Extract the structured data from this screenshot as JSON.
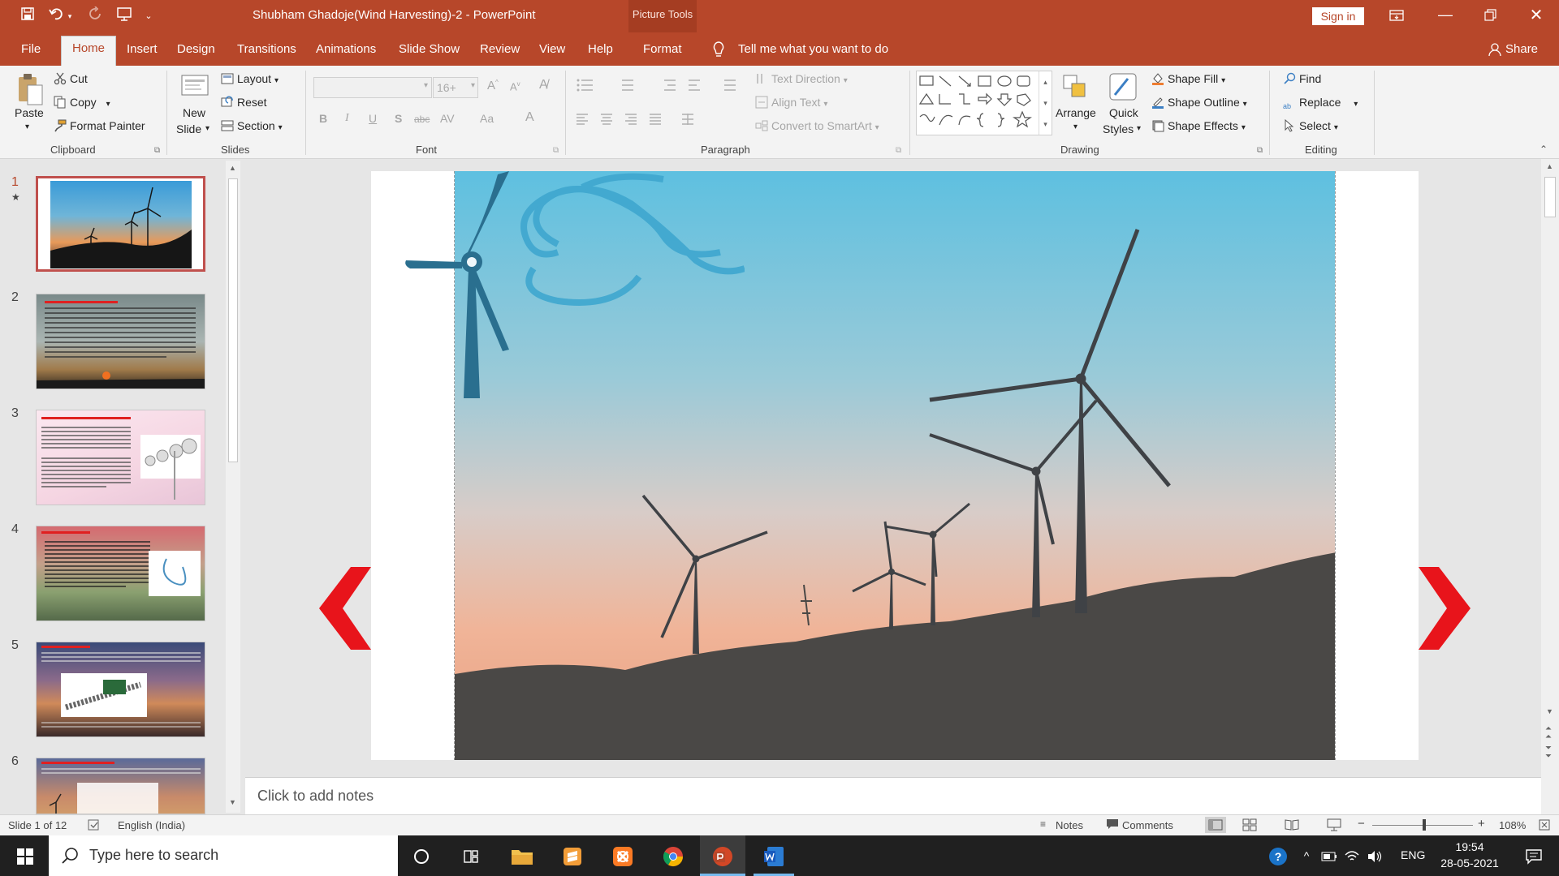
{
  "window": {
    "title": "Shubham Ghadoje(Wind Harvesting)-2  -  PowerPoint",
    "contextual_group": "Picture Tools",
    "sign_in": "Sign in"
  },
  "tabs": [
    "File",
    "Home",
    "Insert",
    "Design",
    "Transitions",
    "Animations",
    "Slide Show",
    "Review",
    "View",
    "Help",
    "Format"
  ],
  "tell_me": "Tell me what you want to do",
  "share": "Share",
  "ribbon": {
    "clipboard": {
      "paste": "Paste",
      "cut": "Cut",
      "copy": "Copy",
      "format_painter": "Format Painter",
      "label": "Clipboard"
    },
    "slides": {
      "new_slide_1": "New",
      "new_slide_2": "Slide",
      "layout": "Layout",
      "reset": "Reset",
      "section": "Section",
      "label": "Slides"
    },
    "font": {
      "size": "16+",
      "label": "Font",
      "bold": "B",
      "italic": "I",
      "underline": "U",
      "shadow": "S",
      "strike": "abc",
      "spacing": "AV",
      "case": "Aa",
      "color": "A"
    },
    "paragraph": {
      "text_direction": "Text Direction",
      "align_text": "Align Text",
      "convert_smartart": "Convert to SmartArt",
      "label": "Paragraph"
    },
    "drawing": {
      "arrange": "Arrange",
      "quick_1": "Quick",
      "quick_2": "Styles",
      "shape_fill": "Shape Fill",
      "shape_outline": "Shape Outline",
      "shape_effects": "Shape Effects",
      "label": "Drawing"
    },
    "editing": {
      "find": "Find",
      "replace": "Replace",
      "select": "Select",
      "label": "Editing"
    }
  },
  "slides": [
    {
      "num": "1",
      "star": "★"
    },
    {
      "num": "2"
    },
    {
      "num": "3"
    },
    {
      "num": "4"
    },
    {
      "num": "5"
    },
    {
      "num": "6"
    }
  ],
  "notes_placeholder": "Click to add notes",
  "status": {
    "slide_info": "Slide 1 of 12",
    "language": "English (India)",
    "notes": "Notes",
    "comments": "Comments",
    "zoom": "108%"
  },
  "taskbar": {
    "search_placeholder": "Type here to search",
    "lang": "ENG",
    "time": "19:54",
    "date": "28-05-2021"
  },
  "colors": {
    "accent": "#b7472a",
    "nav_arrow": "#e8141b"
  }
}
